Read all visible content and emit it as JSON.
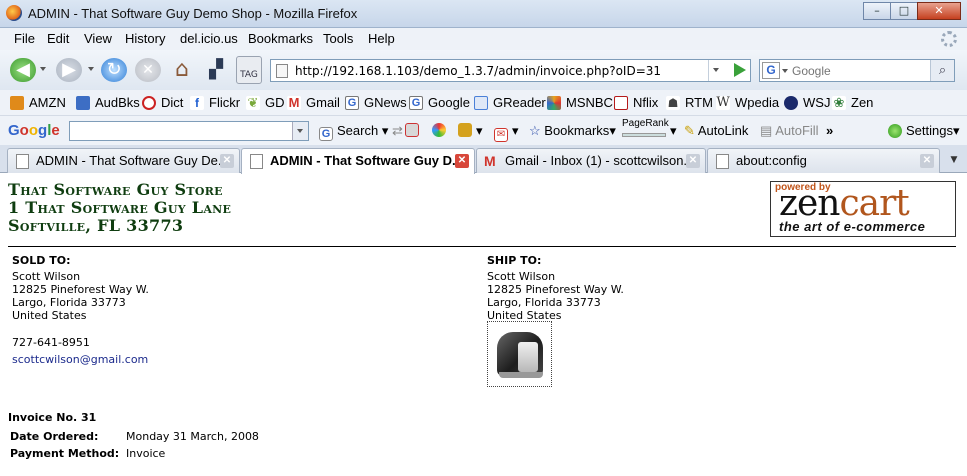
{
  "window": {
    "title": "ADMIN - That Software Guy Demo Shop - Mozilla Firefox"
  },
  "menu": [
    "File",
    "Edit",
    "View",
    "History",
    "del.icio.us",
    "Bookmarks",
    "Tools",
    "Help"
  ],
  "nav": {
    "tag_label": "TAG",
    "url": "http://192.168.1.103/demo_1.3.7/admin/invoice.php?oID=31",
    "search_placeholder": "Google",
    "search_engine": "G"
  },
  "bookmarks": [
    {
      "label": "AMZN",
      "color": "#e08a1a"
    },
    {
      "label": "AudBks",
      "color": "#3d6ec4"
    },
    {
      "label": "Dict",
      "color": "#c22"
    },
    {
      "label": "Flickr",
      "color": "#1f5fd1"
    },
    {
      "label": "GD",
      "color": "#7aa93a"
    },
    {
      "label": "Gmail",
      "color": "#d0342c"
    },
    {
      "label": "GNews",
      "color": "#3366cc"
    },
    {
      "label": "Google",
      "color": "#3366cc"
    },
    {
      "label": "GReader",
      "color": "#4a80d8"
    },
    {
      "label": "MSNBC",
      "color": "#e7a31c"
    },
    {
      "label": "Nflix",
      "color": "#b51a1a"
    },
    {
      "label": "RTM",
      "color": "#444"
    },
    {
      "label": "Wpedia",
      "color": "#333"
    },
    {
      "label": "WSJ",
      "color": "#222"
    },
    {
      "label": "Zen",
      "color": "#2f7d3a"
    }
  ],
  "google_toolbar": {
    "logo": [
      "G",
      "o",
      "o",
      "g",
      "l",
      "e"
    ],
    "search_label": "Search",
    "bookmarks_label": "Bookmarks",
    "pagerank_label": "PageRank",
    "autolink_label": "AutoLink",
    "autofill_label": "AutoFill",
    "more_label": "»",
    "settings_label": "Settings"
  },
  "tabs": [
    {
      "label": "ADMIN - That Software Guy De...",
      "active": false
    },
    {
      "label": "ADMIN - That Software Guy D...",
      "active": true
    },
    {
      "label": "Gmail - Inbox (1) - scottcwilson...",
      "active": false
    },
    {
      "label": "about:config",
      "active": false
    }
  ],
  "store": {
    "line1": "That Software Guy Store",
    "line2": "1 That Software Guy Lane",
    "line3": "Softville, FL 33773"
  },
  "logo": {
    "powered_by": "powered by",
    "zen": "zen",
    "cart": "cart",
    "tagline": "the art of e-commerce"
  },
  "sold_to": {
    "label": "SOLD TO:",
    "name": "Scott Wilson",
    "street": "12825 Pineforest Way W.",
    "city": "Largo, Florida 33773",
    "country": "United States",
    "phone": "727-641-8951",
    "email": "scottcwilson@gmail.com"
  },
  "ship_to": {
    "label": "SHIP TO:",
    "name": "Scott Wilson",
    "street": "12825 Pineforest Way W.",
    "city": "Largo, Florida 33773",
    "country": "United States"
  },
  "invoice": {
    "number_label": "Invoice No. 31",
    "date_label": "Date Ordered:",
    "date_value": "Monday 31 March, 2008",
    "payment_label": "Payment Method:",
    "payment_value": "Invoice"
  }
}
